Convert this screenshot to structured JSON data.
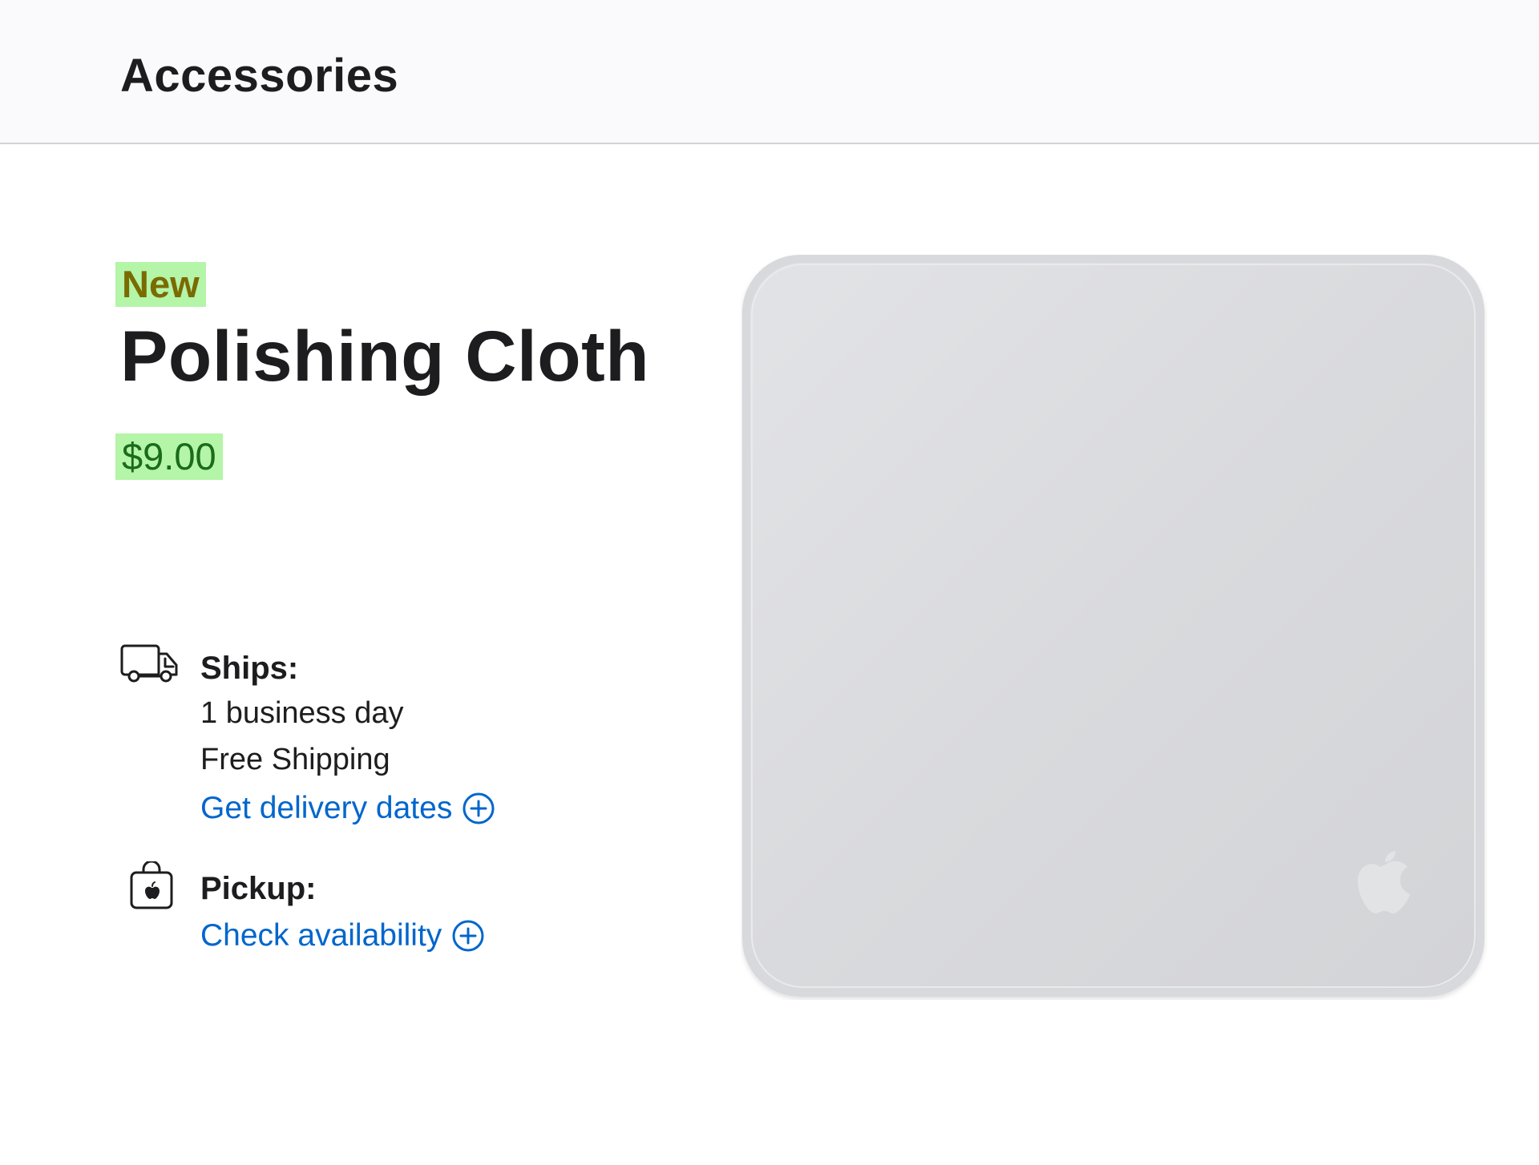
{
  "header": {
    "title": "Accessories"
  },
  "product": {
    "badge": "New",
    "title": "Polishing Cloth",
    "price": "$9.00",
    "image_icon": "apple-logo-icon"
  },
  "ships": {
    "icon": "truck-icon",
    "heading": "Ships:",
    "line1": "1 business day",
    "line2": "Free Shipping",
    "link_label": "Get delivery dates",
    "link_icon": "plus-circle-icon"
  },
  "pickup": {
    "icon": "shopping-bag-icon",
    "heading": "Pickup:",
    "link_label": "Check availability",
    "link_icon": "plus-circle-icon"
  },
  "colors": {
    "highlight": "#b4f5a8",
    "link": "#0066cc",
    "text": "#1d1d1f",
    "cloth": "#dcdde0"
  }
}
